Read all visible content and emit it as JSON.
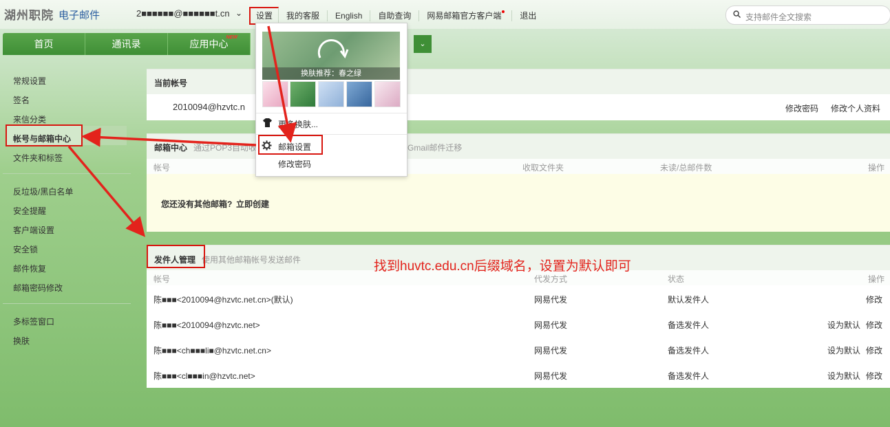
{
  "header": {
    "logo": "湖州职院",
    "logo_sub": "电子邮件",
    "account": "2■■■■■■@■■■■■■t.cn",
    "nav": [
      "设置",
      "我的客服",
      "English",
      "自助查询",
      "网易邮箱官方客户端",
      "退出"
    ],
    "search_placeholder": "支持邮件全文搜索"
  },
  "mainnav": {
    "tabs": [
      "首页",
      "通讯录",
      "应用中心"
    ],
    "new_badge": "NEW"
  },
  "sidebar": {
    "items": [
      "常规设置",
      "签名",
      "来信分类",
      "帐号与邮箱中心",
      "文件夹和标签",
      "反垃圾/黑白名单",
      "安全提醒",
      "客户端设置",
      "安全锁",
      "邮件恢复",
      "邮箱密码修改",
      "多标签窗口",
      "换肤"
    ]
  },
  "current_account": {
    "title": "当前帐号",
    "value": "2010094@hzvtc.n",
    "change_password": "修改密码",
    "edit_profile": "修改个人资料"
  },
  "mailbox_center": {
    "title": "邮箱中心",
    "subtitle_left": "通过POP3自动收",
    "subtitle_right": "Gmail邮件迁移",
    "col_account": "帐号",
    "col_folder": "收取文件夹",
    "col_unread": "未读/总邮件数",
    "col_ops": "操作",
    "empty_text": "您还没有其他邮箱?",
    "create_link": "立即创建"
  },
  "sender_mgmt": {
    "title": "发件人管理",
    "subtitle": "使用其他邮箱帐号发送邮件",
    "col_account": "帐号",
    "col_method": "代发方式",
    "col_status": "状态",
    "col_ops": "操作",
    "rows": [
      {
        "account": "陈■■■<2010094@hzvtc.net.cn>(默认)",
        "method": "网易代发",
        "status": "默认发件人",
        "set_default": "",
        "edit": "修改"
      },
      {
        "account": "陈■■■<2010094@hzvtc.net>",
        "method": "网易代发",
        "status": "备选发件人",
        "set_default": "设为默认",
        "edit": "修改"
      },
      {
        "account": "陈■■■<ch■■■li■@hzvtc.net.cn>",
        "method": "网易代发",
        "status": "备选发件人",
        "set_default": "设为默认",
        "edit": "修改"
      },
      {
        "account": "陈■■■<cl■■■in@hzvtc.net>",
        "method": "网易代发",
        "status": "备选发件人",
        "set_default": "设为默认",
        "edit": "修改"
      }
    ]
  },
  "dropdown": {
    "skin_caption": "换肤推荐：春之绿",
    "more_skins": "更多换肤...",
    "mail_settings": "邮箱设置",
    "change_password": "修改密码"
  },
  "annotation": "找到huvtc.edu.cn后缀域名，设置为默认即可",
  "colors": {
    "accent_green": "#3f8f36",
    "annotation_red": "#d8160f"
  }
}
